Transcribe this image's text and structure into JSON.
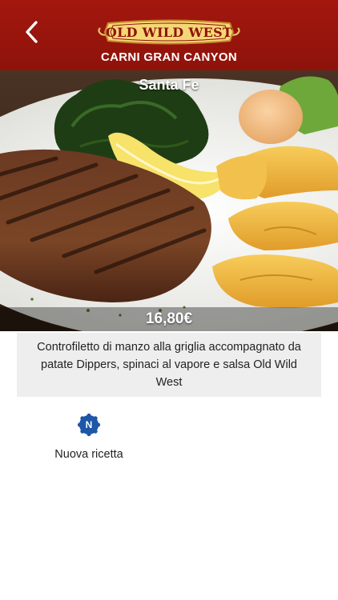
{
  "header": {
    "logo_text": "OLD WILD WEST",
    "category": "CARNI GRAN CANYON",
    "background_color": "#a3170e",
    "back_icon": "chevron-left-icon"
  },
  "dish": {
    "name": "Santa Fe",
    "price": "16,80€",
    "description": "Controfiletto di manzo alla griglia accompagnato da patate Dippers, spinaci al vapore e salsa Old Wild West"
  },
  "badges": [
    {
      "letter": "N",
      "label": "Nuova ricetta",
      "color": "#1e56a8",
      "icon": "new-badge-icon"
    }
  ]
}
